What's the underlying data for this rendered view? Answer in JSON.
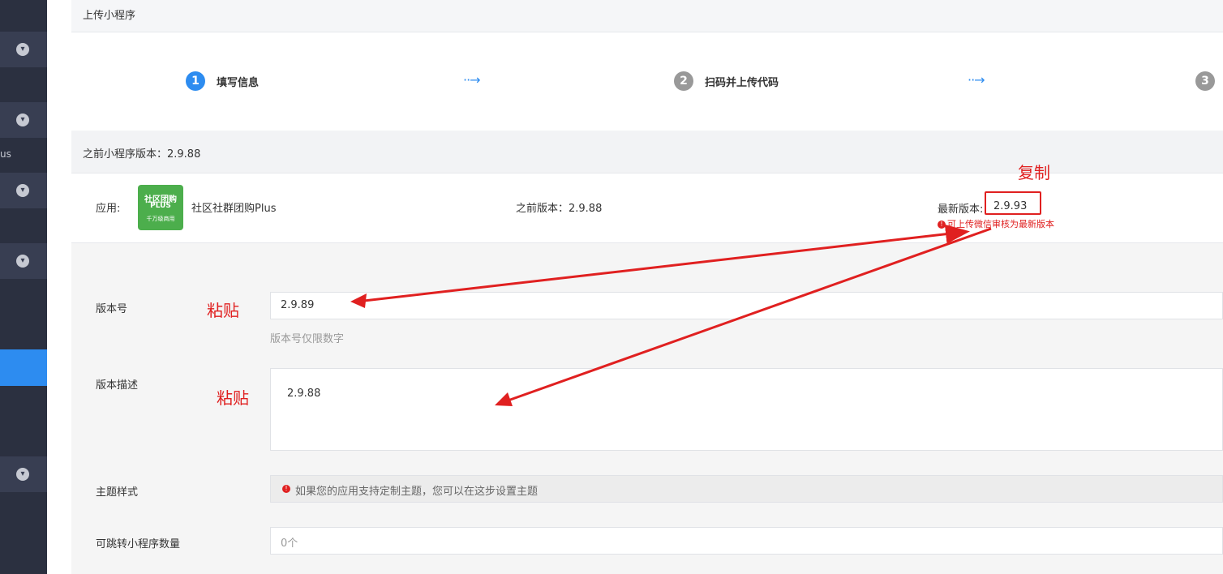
{
  "sidebar": {
    "clipped_text": "us"
  },
  "breadcrumb": {
    "title": "上传小程序"
  },
  "steps": [
    {
      "number": "1",
      "label": "填写信息",
      "color": "#2d8cf0"
    },
    {
      "number": "2",
      "label": "扫码并上传代码",
      "color": "#999999"
    },
    {
      "number": "3",
      "label": "",
      "color": "#999999"
    }
  ],
  "step_arrow": "··→",
  "previous_version_bar": "之前小程序版本：2.9.88",
  "app": {
    "label": "应用:",
    "logo": {
      "line1": "社区团购",
      "line2": "PLUS",
      "line3": "千万级商用"
    },
    "name": "社区社群团购Plus",
    "previous_version": "之前版本：2.9.88",
    "latest_label": "最新版本:",
    "latest_value": "2.9.93",
    "latest_note": "可上传微信审核为最新版本"
  },
  "form": {
    "version_label": "版本号",
    "version_value": "2.9.89",
    "version_hint": "版本号仅限数字",
    "desc_label": "版本描述",
    "desc_value": "2.9.88",
    "theme_label": "主题样式",
    "theme_note": "如果您的应用支持定制主题，您可以在这步设置主题",
    "jump_label": "可跳转小程序数量",
    "jump_value": "0个"
  },
  "annotations": {
    "copy": "复制",
    "paste1": "粘贴",
    "paste2": "粘贴",
    "color": "#e02020"
  }
}
